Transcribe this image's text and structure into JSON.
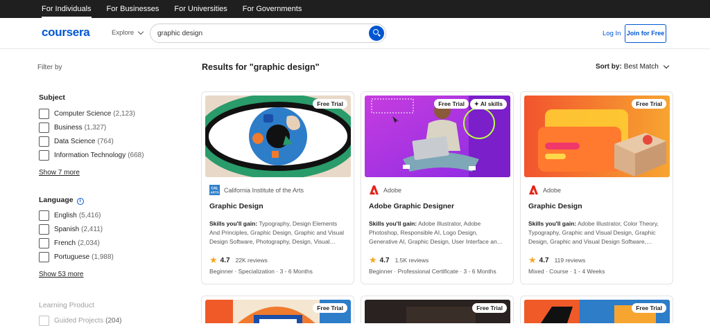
{
  "topnav": [
    "For Individuals",
    "For Businesses",
    "For Universities",
    "For Governments"
  ],
  "header": {
    "logo": "coursera",
    "explore": "Explore",
    "search_value": "graphic design",
    "login": "Log In",
    "join": "Join for Free"
  },
  "filters": {
    "filter_by": "Filter by",
    "subject": {
      "title": "Subject",
      "options": [
        {
          "label": "Computer Science",
          "count": "(2,123)"
        },
        {
          "label": "Business",
          "count": "(1,327)"
        },
        {
          "label": "Data Science",
          "count": "(764)"
        },
        {
          "label": "Information Technology",
          "count": "(668)"
        }
      ],
      "show_more": "Show 7 more"
    },
    "language": {
      "title": "Language",
      "options": [
        {
          "label": "English",
          "count": "(5,416)"
        },
        {
          "label": "Spanish",
          "count": "(2,411)"
        },
        {
          "label": "French",
          "count": "(2,034)"
        },
        {
          "label": "Portuguese",
          "count": "(1,988)"
        }
      ],
      "show_more": "Show 53 more"
    },
    "learning_product": {
      "title": "Learning Product",
      "options": [
        {
          "label": "Guided Projects",
          "count": "(204)"
        }
      ]
    }
  },
  "results": {
    "title": "Results for \"graphic design\"",
    "sort_label": "Sort by:",
    "sort_value": "Best Match"
  },
  "cards": [
    {
      "badge": "Free Trial",
      "partner": "California Institute of the Arts",
      "title": "Graphic Design",
      "skills_label": "Skills you'll gain:",
      "skills": "Typography, Design Elements And Principles, Graphic Design, Graphic and Visual Design Software, Photography, Design, Visual…",
      "rating": "4.7",
      "reviews": "22K reviews",
      "meta": "Beginner · Specialization · 3 - 6 Months"
    },
    {
      "badge": "Free Trial",
      "badge2": "AI skills",
      "partner": "Adobe",
      "title": "Adobe Graphic Designer",
      "skills_label": "Skills you'll gain:",
      "skills": "Adobe Illustrator, Adobe Photoshop, Responsible AI, Logo Design, Generative AI, Graphic Design, User Interface an…",
      "rating": "4.7",
      "reviews": "1.5K reviews",
      "meta": "Beginner · Professional Certificate · 3 - 6 Months"
    },
    {
      "badge": "Free Trial",
      "partner": "Adobe",
      "title": "Graphic Design",
      "skills_label": "Skills you'll gain:",
      "skills": "Adobe Illustrator, Color Theory, Typography, Graphic and Visual Design, Graphic Design, Graphic and Visual Design Software,…",
      "rating": "4.7",
      "reviews": "119 reviews",
      "meta": "Mixed · Course · 1 - 4 Weeks"
    }
  ],
  "partial_cards": [
    {
      "badge": "Free Trial"
    },
    {
      "badge": "Free Trial"
    },
    {
      "badge": "Free Trial"
    }
  ],
  "colors": {
    "brand": "#0056d2",
    "star": "#f5a623"
  }
}
